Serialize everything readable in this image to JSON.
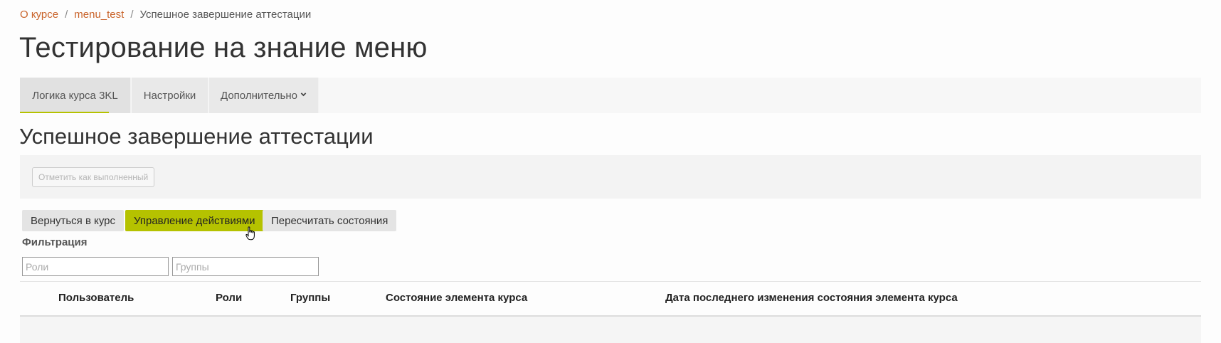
{
  "breadcrumb": {
    "items": [
      "О курсе",
      "menu_test"
    ],
    "separator": "/",
    "current": "Успешное завершение аттестации"
  },
  "page_title": "Тестирование на знание меню",
  "tabs": [
    {
      "label": "Логика курса 3KL",
      "active": true
    },
    {
      "label": "Настройки",
      "active": false
    },
    {
      "label": "Дополнительно",
      "active": false,
      "icon": "chevron-down-icon"
    }
  ],
  "section_title": "Успешное завершение аттестации",
  "mark_complete_button": "Отметить как выполненный",
  "actions": {
    "back": "Вернуться в курс",
    "manage": "Управление действиями",
    "recalc": "Пересчитать состояния"
  },
  "filter": {
    "label": "Фильтрация",
    "roles_placeholder": "Роли",
    "groups_placeholder": "Группы"
  },
  "table": {
    "columns": [
      "Пользователь",
      "Роли",
      "Группы",
      "Состояние элемента курса",
      "Дата последнего изменения состояния элемента курса"
    ]
  },
  "colors": {
    "link": "#c9632a",
    "accent": "#b5c200",
    "tab_bg": "#e9e9e9"
  }
}
